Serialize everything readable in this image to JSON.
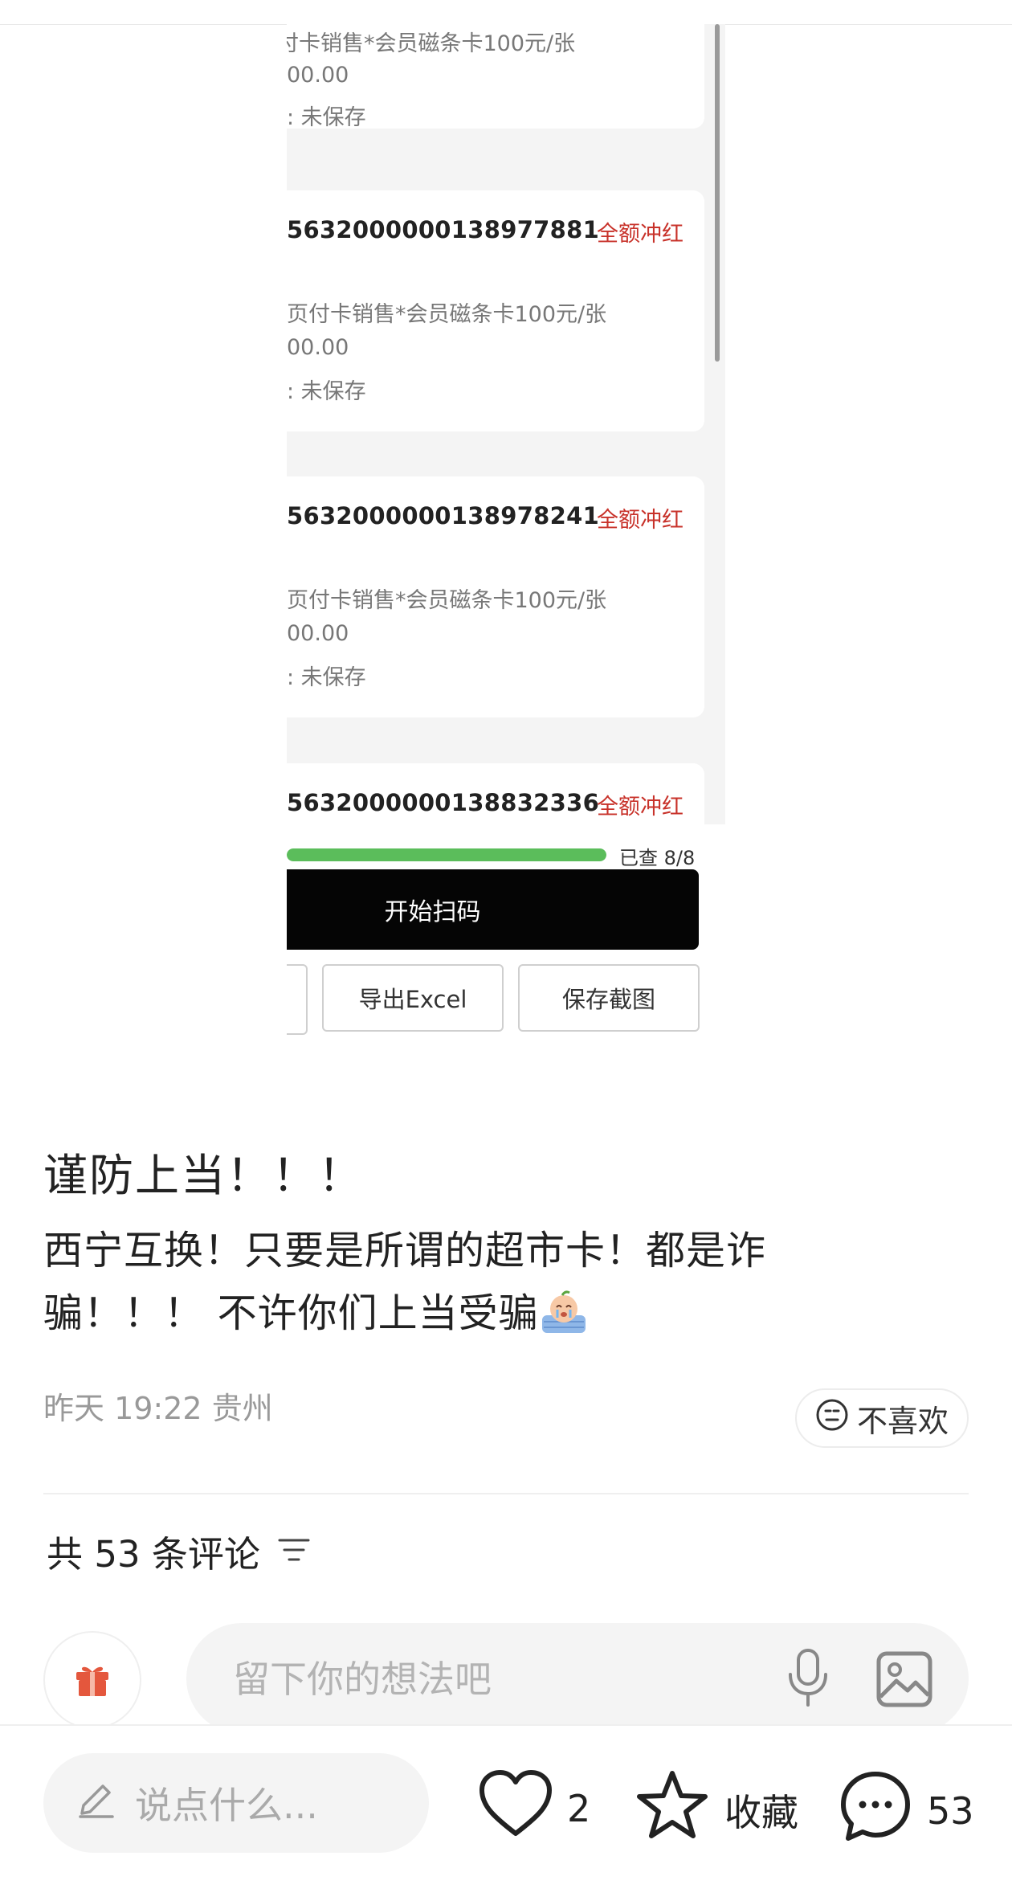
{
  "screenshot": {
    "cards": [
      {
        "code": "",
        "status": "",
        "product": "付卡销售*会员磁条卡100元/张",
        "amount": "00.00",
        "save_status": ": 未保存"
      },
      {
        "code": "5632000000138977881",
        "status": "全额冲红",
        "product": "页付卡销售*会员磁条卡100元/张",
        "amount": "00.00",
        "save_status": ": 未保存"
      },
      {
        "code": "5632000000138978241",
        "status": "全额冲红",
        "product": "页付卡销售*会员磁条卡100元/张",
        "amount": "00.00",
        "save_status": ": 未保存"
      },
      {
        "code": "5632000000138832336",
        "status": "全额冲红"
      }
    ],
    "progress": {
      "label": "已查 8/8",
      "fraction": 1.0,
      "color": "#5bbd5b"
    },
    "scan_button": "开始扫码",
    "export_button": "导出Excel",
    "save_screenshot_button": "保存截图"
  },
  "post": {
    "title": "谨防上当！！！",
    "body_line1": "西宁互换！只要是所谓的超市卡！都是诈",
    "body_line2": "骗！！！ 不许你们上当受骗",
    "emoji_icon": "crying-face-emoji-icon",
    "date": "昨天 19:22",
    "location": "贵州",
    "dislike_label": "不喜欢"
  },
  "comments": {
    "count_prefix": "共",
    "count": "53",
    "count_suffix": "条评论",
    "input_placeholder": "留下你的想法吧"
  },
  "bottom_bar": {
    "say_placeholder": "说点什么...",
    "likes": "2",
    "collect_label": "收藏",
    "comments": "53"
  },
  "colors": {
    "accent_red": "#c8322a",
    "progress_green": "#5bbd5b",
    "text_main": "#222222",
    "text_muted": "#999999"
  }
}
